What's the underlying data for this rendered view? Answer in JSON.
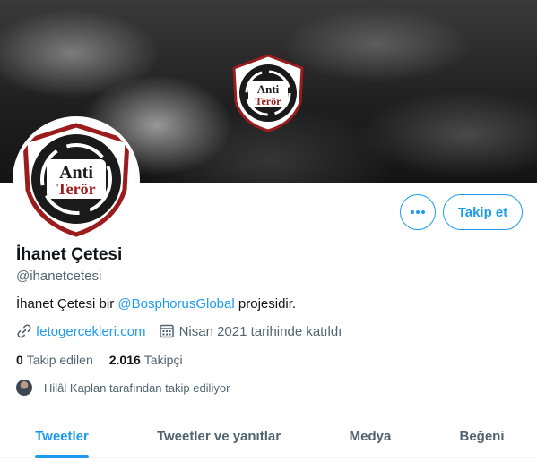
{
  "profile": {
    "name": "İhanet Çetesi",
    "handle": "@ihanetcetesi",
    "bio_text": "İhanet Çetesi bir",
    "bio_mention": "@BosphorusGlobal",
    "bio_suffix": "projesidir.",
    "website": "fetogercekleri.com",
    "joined": "Nisan 2021 tarihinde katıldı",
    "logo_line1": "Anti",
    "logo_line2": "Terör"
  },
  "actions": {
    "follow_label": "Takip et",
    "more_icon": "more-dots-icon"
  },
  "stats": {
    "following_count": "0",
    "following_label": "Takip edilen",
    "followers_count": "2.016",
    "followers_label": "Takipçi"
  },
  "followed_by": {
    "text": "Hilâl Kaplan tarafından takip ediliyor"
  },
  "tabs": [
    {
      "label": "Tweetler",
      "active": true
    },
    {
      "label": "Tweetler ve yanıtlar",
      "active": false
    },
    {
      "label": "Medya",
      "active": false
    },
    {
      "label": "Beğeni",
      "active": false
    }
  ],
  "colors": {
    "accent": "#1d9bf0",
    "logo_red": "#9b1c1c",
    "text_secondary": "#536471"
  }
}
